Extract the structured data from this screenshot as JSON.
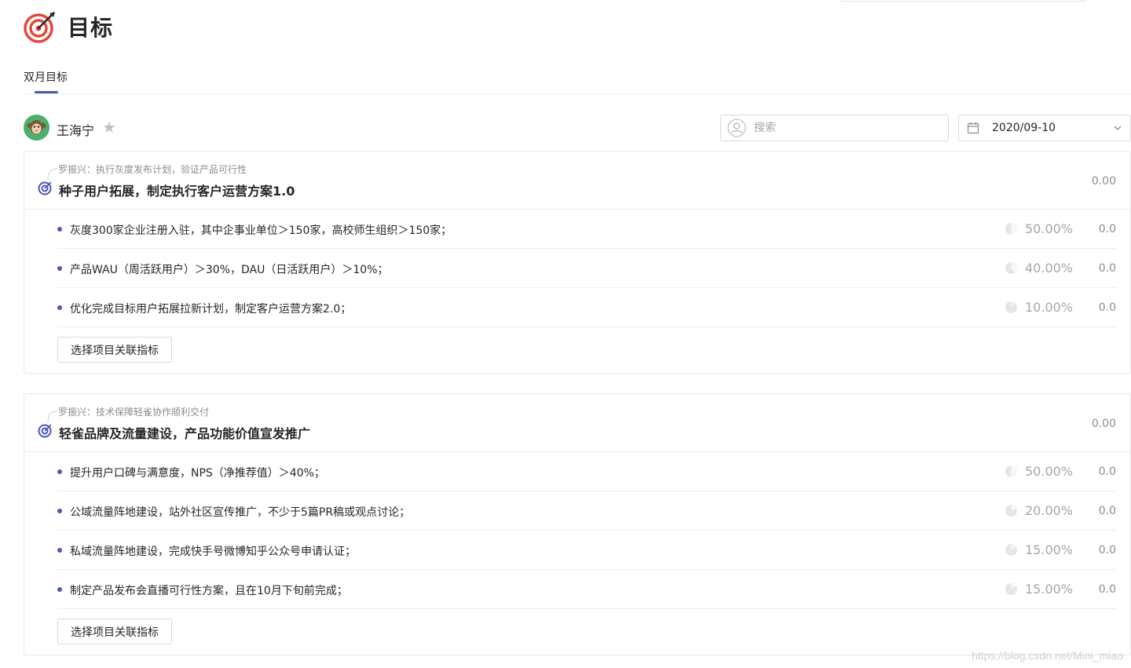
{
  "page": {
    "title": "目标"
  },
  "tabs": [
    {
      "label": "双月目标",
      "active": true
    }
  ],
  "owner": {
    "name": "王海宁",
    "favorited": false
  },
  "search": {
    "placeholder": "搜索",
    "value": ""
  },
  "date_picker": {
    "value": "2020/09-10"
  },
  "objectives": [
    {
      "parent": "罗振兴：执行灰度发布计划，验证产品可行性",
      "title": "种子用户拓展，制定执行客户运营方案1.0",
      "score": "0.00",
      "key_results": [
        {
          "text": "灰度300家企业注册入驻，其中企事业单位＞150家，高校师生组织＞150家；",
          "weight": "50.00%",
          "weight_value": 50,
          "score": "0.0"
        },
        {
          "text": "产品WAU（周活跃用户）＞30%，DAU（日活跃用户）＞10%；",
          "weight": "40.00%",
          "weight_value": 40,
          "score": "0.0"
        },
        {
          "text": "优化完成目标用户拓展拉新计划，制定客户运营方案2.0；",
          "weight": "10.00%",
          "weight_value": 10,
          "score": "0.0"
        }
      ],
      "link_button": "选择项目关联指标"
    },
    {
      "parent": "罗振兴：技术保障轻雀协作顺利交付",
      "title": "轻雀品牌及流量建设，产品功能价值宣发推广",
      "score": "0.00",
      "key_results": [
        {
          "text": "提升用户口碑与满意度，NPS（净推荐值）＞40%；",
          "weight": "50.00%",
          "weight_value": 50,
          "score": "0.0"
        },
        {
          "text": "公域流量阵地建设，站外社区宣传推广，不少于5篇PR稿或观点讨论；",
          "weight": "20.00%",
          "weight_value": 20,
          "score": "0.0"
        },
        {
          "text": "私域流量阵地建设，完成快手号微博知乎公众号申请认证；",
          "weight": "15.00%",
          "weight_value": 15,
          "score": "0.0"
        },
        {
          "text": "制定产品发布会直播可行性方案，且在10月下旬前完成；",
          "weight": "15.00%",
          "weight_value": 15,
          "score": "0.0"
        }
      ],
      "link_button": "选择项目关联指标"
    }
  ],
  "watermark": "https://blog.csdn.net/Mini_miao",
  "colors": {
    "accent": "#4b57b4",
    "logo_red": "#e4473a",
    "avatar_bg": "#4caf6a"
  }
}
